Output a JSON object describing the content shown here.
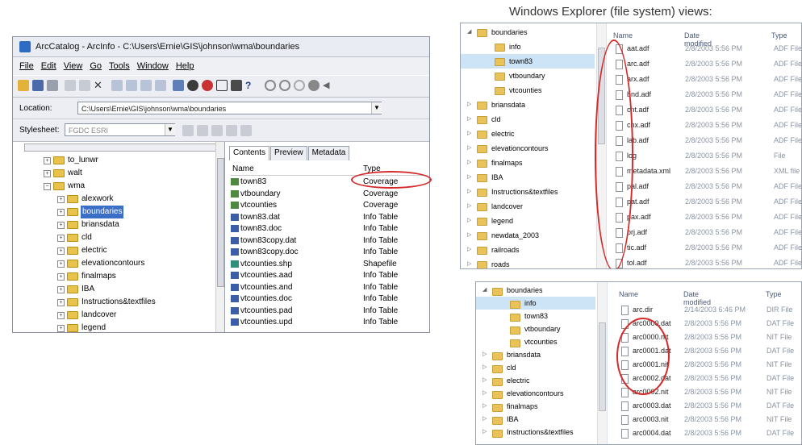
{
  "heading": "Windows Explorer (file system) views:",
  "arccatalog": {
    "title": "ArcCatalog - ArcInfo - C:\\Users\\Ernie\\GIS\\johnson\\wma\\boundaries",
    "menu": [
      "File",
      "Edit",
      "View",
      "Go",
      "Tools",
      "Window",
      "Help"
    ],
    "location_label": "Location:",
    "location_value": "C:\\Users\\Ernie\\GIS\\johnson\\wma\\boundaries",
    "stylesheet_label": "Stylesheet:",
    "stylesheet_value": "FGDC ESRI",
    "tree": [
      "to_lunwr",
      "walt",
      "wma",
      "alexwork",
      "boundaries",
      "briansdata",
      "cld",
      "electric",
      "elevationcontours",
      "finalmaps",
      "IBA",
      "Instructions&textfiles",
      "landcover",
      "legend"
    ],
    "tabs": [
      "Contents",
      "Preview",
      "Metadata"
    ],
    "col_name": "Name",
    "col_type": "Type",
    "contents": [
      {
        "name": "town83",
        "type": "Coverage"
      },
      {
        "name": "vtboundary",
        "type": "Coverage"
      },
      {
        "name": "vtcounties",
        "type": "Coverage"
      },
      {
        "name": "town83.dat",
        "type": "Info Table"
      },
      {
        "name": "town83.doc",
        "type": "Info Table"
      },
      {
        "name": "town83copy.dat",
        "type": "Info Table"
      },
      {
        "name": "town83copy.doc",
        "type": "Info Table"
      },
      {
        "name": "vtcounties.shp",
        "type": "Shapefile"
      },
      {
        "name": "vtcounties.aad",
        "type": "Info Table"
      },
      {
        "name": "vtcounties.and",
        "type": "Info Table"
      },
      {
        "name": "vtcounties.doc",
        "type": "Info Table"
      },
      {
        "name": "vtcounties.pad",
        "type": "Info Table"
      },
      {
        "name": "vtcounties.upd",
        "type": "Info Table"
      }
    ]
  },
  "explorer1": {
    "nav": [
      "boundaries",
      "info",
      "town83",
      "vtboundary",
      "vtcounties",
      "briansdata",
      "cld",
      "electric",
      "elevationcontours",
      "finalmaps",
      "IBA",
      "Instructions&textfiles",
      "landcover",
      "legend",
      "newdata_2003",
      "railroads",
      "roads"
    ],
    "col_name": "Name",
    "col_date": "Date modified",
    "col_type": "Type",
    "files": [
      {
        "name": "aat.adf",
        "date": "2/8/2003 5:56 PM",
        "type": "ADF File"
      },
      {
        "name": "arc.adf",
        "date": "2/8/2003 5:56 PM",
        "type": "ADF File"
      },
      {
        "name": "arx.adf",
        "date": "2/8/2003 5:56 PM",
        "type": "ADF File"
      },
      {
        "name": "bnd.adf",
        "date": "2/8/2003 5:56 PM",
        "type": "ADF File"
      },
      {
        "name": "cnt.adf",
        "date": "2/8/2003 5:56 PM",
        "type": "ADF File"
      },
      {
        "name": "cnx.adf",
        "date": "2/8/2003 5:56 PM",
        "type": "ADF File"
      },
      {
        "name": "lab.adf",
        "date": "2/8/2003 5:56 PM",
        "type": "ADF File"
      },
      {
        "name": "log",
        "date": "2/8/2003 5:56 PM",
        "type": "File"
      },
      {
        "name": "metadata.xml",
        "date": "2/8/2003 5:56 PM",
        "type": "XML file"
      },
      {
        "name": "pal.adf",
        "date": "2/8/2003 5:56 PM",
        "type": "ADF File"
      },
      {
        "name": "pat.adf",
        "date": "2/8/2003 5:56 PM",
        "type": "ADF File"
      },
      {
        "name": "pax.adf",
        "date": "2/8/2003 5:56 PM",
        "type": "ADF File"
      },
      {
        "name": "prj.adf",
        "date": "2/8/2003 5:56 PM",
        "type": "ADF File"
      },
      {
        "name": "tic.adf",
        "date": "2/8/2003 5:56 PM",
        "type": "ADF File"
      },
      {
        "name": "tol.adf",
        "date": "2/8/2003 5:56 PM",
        "type": "ADF File"
      }
    ]
  },
  "explorer2": {
    "nav": [
      "boundaries",
      "info",
      "town83",
      "vtboundary",
      "vtcounties",
      "briansdata",
      "cld",
      "electric",
      "elevationcontours",
      "finalmaps",
      "IBA",
      "Instructions&textfiles"
    ],
    "col_name": "Name",
    "col_date": "Date modified",
    "col_type": "Type",
    "files": [
      {
        "name": "arc.dir",
        "date": "2/14/2003 6:46 PM",
        "type": "DIR File"
      },
      {
        "name": "arc0000.dat",
        "date": "2/8/2003 5:56 PM",
        "type": "DAT File"
      },
      {
        "name": "arc0000.nit",
        "date": "2/8/2003 5:56 PM",
        "type": "NIT File"
      },
      {
        "name": "arc0001.dat",
        "date": "2/8/2003 5:56 PM",
        "type": "DAT File"
      },
      {
        "name": "arc0001.nit",
        "date": "2/8/2003 5:56 PM",
        "type": "NIT File"
      },
      {
        "name": "arc0002.dat",
        "date": "2/8/2003 5:56 PM",
        "type": "DAT File"
      },
      {
        "name": "arc0002.nit",
        "date": "2/8/2003 5:56 PM",
        "type": "NIT File"
      },
      {
        "name": "arc0003.dat",
        "date": "2/8/2003 5:56 PM",
        "type": "DAT File"
      },
      {
        "name": "arc0003.nit",
        "date": "2/8/2003 5:56 PM",
        "type": "NIT File"
      },
      {
        "name": "arc0004.dat",
        "date": "2/8/2003 5:56 PM",
        "type": "DAT File"
      }
    ]
  }
}
